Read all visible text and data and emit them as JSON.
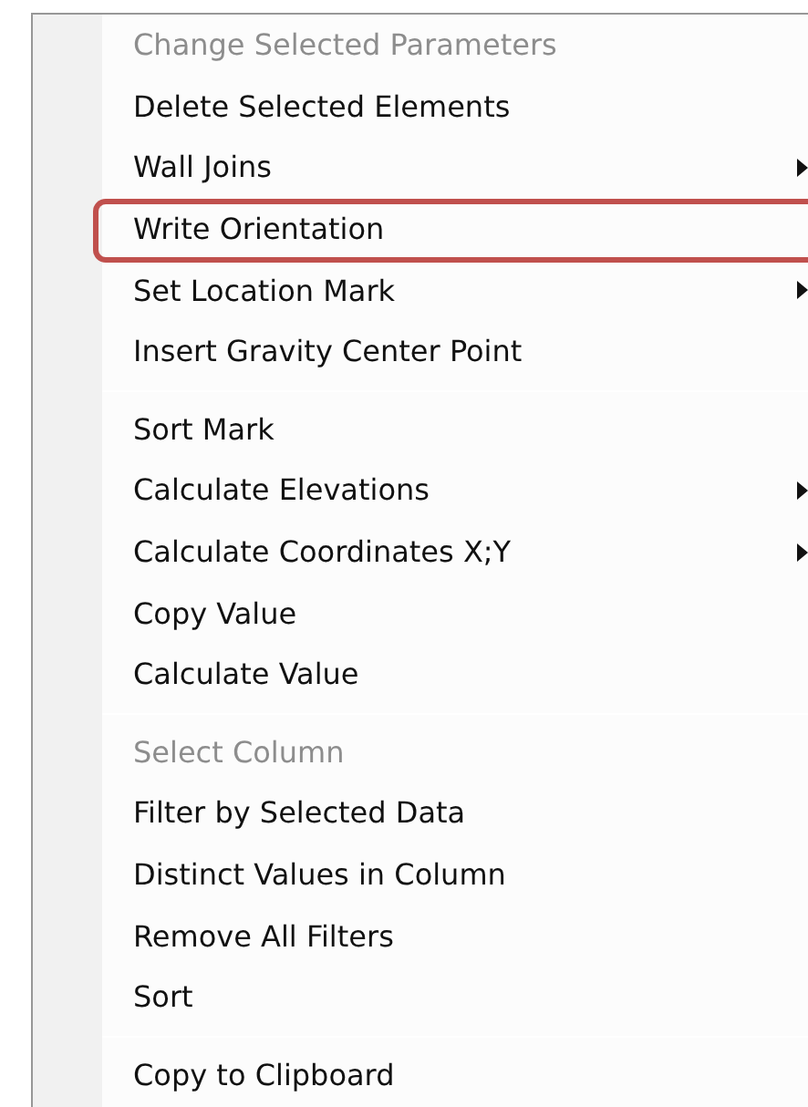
{
  "context_menu": {
    "items": [
      {
        "kind": "item",
        "label": "Change Selected Parameters",
        "disabled": true,
        "submenu": false,
        "highlighted": false
      },
      {
        "kind": "item",
        "label": "Delete Selected Elements",
        "disabled": false,
        "submenu": false,
        "highlighted": false
      },
      {
        "kind": "item",
        "label": "Wall Joins",
        "disabled": false,
        "submenu": true,
        "highlighted": false
      },
      {
        "kind": "item",
        "label": "Write Orientation",
        "disabled": false,
        "submenu": false,
        "highlighted": true
      },
      {
        "kind": "item",
        "label": "Set Location Mark",
        "disabled": false,
        "submenu": true,
        "highlighted": false
      },
      {
        "kind": "item",
        "label": "Insert Gravity Center Point",
        "disabled": false,
        "submenu": false,
        "highlighted": false
      },
      {
        "kind": "separator"
      },
      {
        "kind": "item",
        "label": "Sort Mark",
        "disabled": false,
        "submenu": false,
        "highlighted": false
      },
      {
        "kind": "item",
        "label": "Calculate Elevations",
        "disabled": false,
        "submenu": true,
        "highlighted": false
      },
      {
        "kind": "item",
        "label": "Calculate Coordinates X;Y",
        "disabled": false,
        "submenu": true,
        "highlighted": false
      },
      {
        "kind": "item",
        "label": "Copy Value",
        "disabled": false,
        "submenu": false,
        "highlighted": false
      },
      {
        "kind": "item",
        "label": "Calculate Value",
        "disabled": false,
        "submenu": false,
        "highlighted": false
      },
      {
        "kind": "separator"
      },
      {
        "kind": "item",
        "label": "Select Column",
        "disabled": true,
        "submenu": false,
        "highlighted": false
      },
      {
        "kind": "item",
        "label": "Filter by Selected Data",
        "disabled": false,
        "submenu": false,
        "highlighted": false
      },
      {
        "kind": "item",
        "label": "Distinct Values in Column",
        "disabled": false,
        "submenu": false,
        "highlighted": false
      },
      {
        "kind": "item",
        "label": "Remove All Filters",
        "disabled": false,
        "submenu": false,
        "highlighted": false
      },
      {
        "kind": "item",
        "label": "Sort",
        "disabled": false,
        "submenu": false,
        "highlighted": false
      },
      {
        "kind": "separator"
      },
      {
        "kind": "item",
        "label": "Copy to Clipboard",
        "disabled": false,
        "submenu": false,
        "highlighted": false
      }
    ]
  }
}
